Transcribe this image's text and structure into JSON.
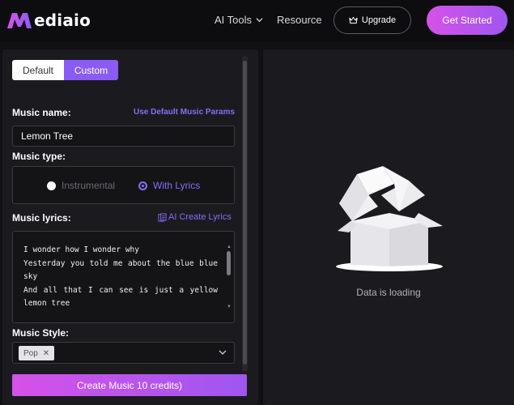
{
  "header": {
    "brand": "ediaio",
    "nav": {
      "ai_tools": "AI Tools",
      "resource": "Resource"
    },
    "upgrade_label": "Upgrade",
    "get_started_label": "Get Started"
  },
  "form": {
    "tabs": {
      "default": "Default",
      "custom": "Custom",
      "active": "Custom"
    },
    "music_name": {
      "label": "Music name:",
      "value": "Lemon Tree",
      "default_params_link": "Use Default Music Params"
    },
    "music_type": {
      "label": "Music type:",
      "options": [
        "Instrumental",
        "With Lyrics"
      ],
      "selected": "With Lyrics"
    },
    "music_lyrics": {
      "label": "Music lyrics:",
      "ai_create_label": "AI Create Lyrics",
      "lines": [
        "I wonder how I wonder why",
        "Yesterday you told me about the blue blue",
        "sky",
        "And all that I can see is just a yellow",
        "lemon tree"
      ]
    },
    "music_style": {
      "label": "Music Style:",
      "selected_tag": "Pop"
    },
    "create_button_label": "Create Music 10 credits)"
  },
  "preview": {
    "status": "Data is loading"
  },
  "colors": {
    "accent": "#8a6cf6",
    "gradient_start": "#d552e8",
    "gradient_end": "#9f56f0",
    "panel_bg": "#1b1b1f",
    "page_bg": "#111114"
  },
  "icons": [
    "logo-m-icon",
    "chevron-down-icon",
    "crown-icon",
    "ai-document-icon",
    "close-icon",
    "empty-box-icon"
  ]
}
